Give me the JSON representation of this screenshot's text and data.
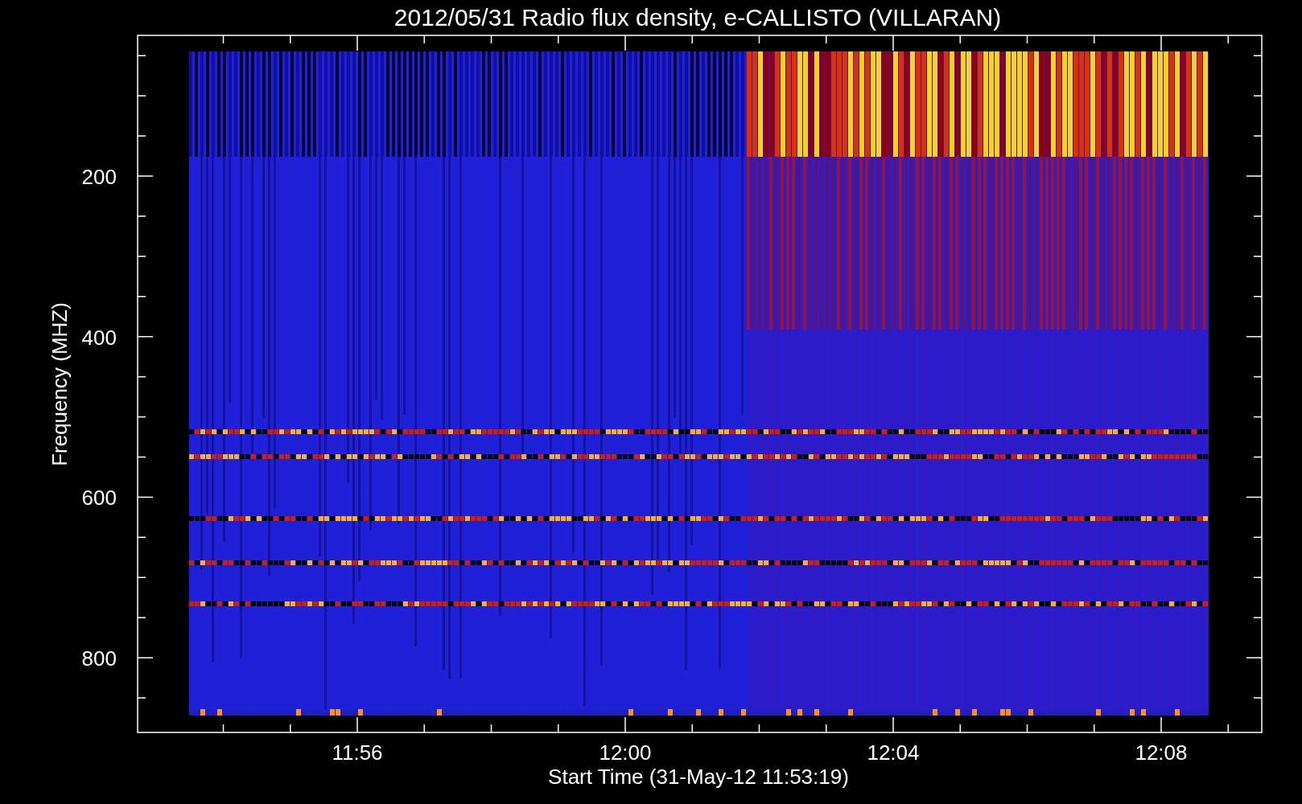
{
  "title": "2012/05/31  Radio flux density, e-CALLISTO (VILLARAN)",
  "ylabel": "Frequency (MHZ)",
  "xlabel": "Start Time (31-May-12 11:53:19)",
  "yticks": [
    "200",
    "400",
    "600",
    "800"
  ],
  "xticks": [
    "11:56",
    "12:00",
    "12:04",
    "12:08"
  ]
}
